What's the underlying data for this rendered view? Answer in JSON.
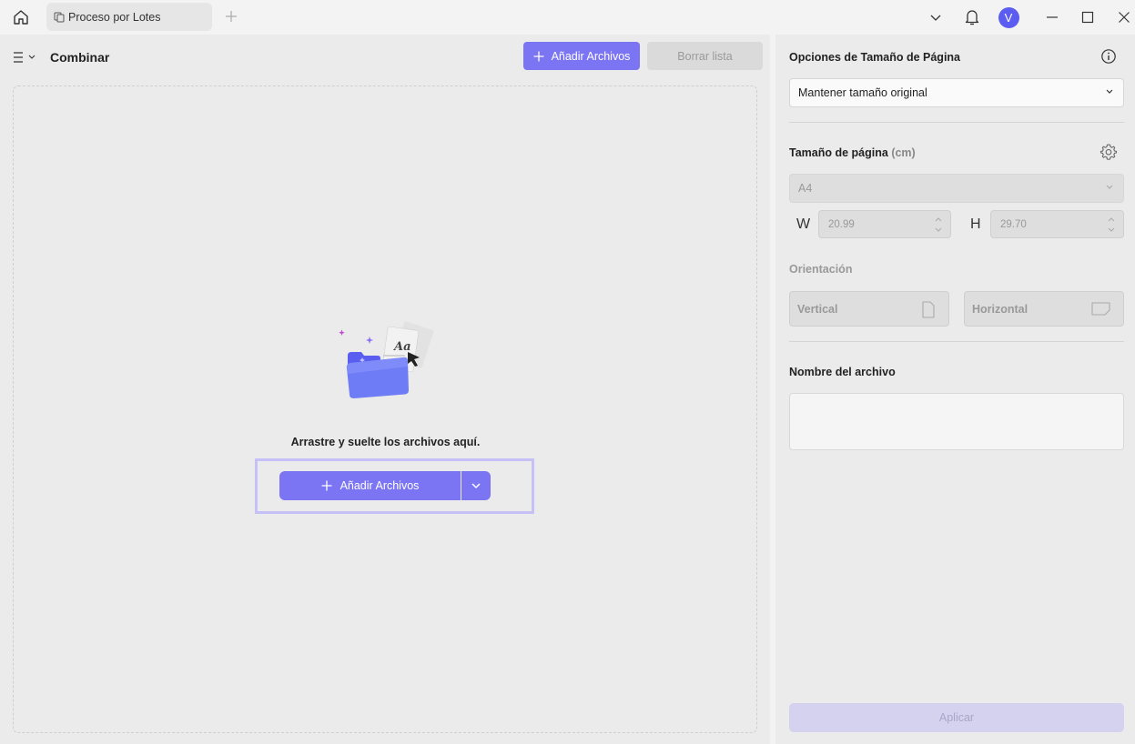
{
  "titlebar": {
    "tab_label": "Proceso por Lotes",
    "avatar_letter": "V"
  },
  "toolbar": {
    "title": "Combinar",
    "add_files_label": "Añadir Archivos",
    "clear_list_label": "Borrar lista"
  },
  "dropzone": {
    "hint": "Arrastre y suelte los archivos aquí.",
    "add_files_label": "Añadir Archivos"
  },
  "options": {
    "page_size_heading": "Opciones de Tamaño de Página",
    "page_size_mode": "Mantener tamaño original",
    "page_size_label": "Tamaño de página",
    "page_size_unit": "(cm)",
    "paper": "A4",
    "width_label": "W",
    "width_value": "20.99",
    "height_label": "H",
    "height_value": "29.70",
    "orientation_heading": "Orientación",
    "orientation_vertical": "Vertical",
    "orientation_horizontal": "Horizontal",
    "filename_heading": "Nombre del archivo",
    "filename_value": "",
    "apply_label": "Aplicar"
  },
  "colors": {
    "accent": "#7b75f4",
    "accent_disabled": "#d4d2ee",
    "panel_bg": "#ebebeb"
  },
  "icons": {
    "home": "home-icon",
    "tab": "pages-icon",
    "new_tab": "plus-icon",
    "dropdown": "chevron-down-icon",
    "notifications": "bell-icon",
    "minimize": "minimize-icon",
    "maximize": "maximize-icon",
    "close": "close-icon",
    "menu": "hamburger-menu-icon",
    "info": "info-icon",
    "settings": "gear-icon",
    "portrait": "portrait-page-icon",
    "landscape": "landscape-page-icon"
  }
}
